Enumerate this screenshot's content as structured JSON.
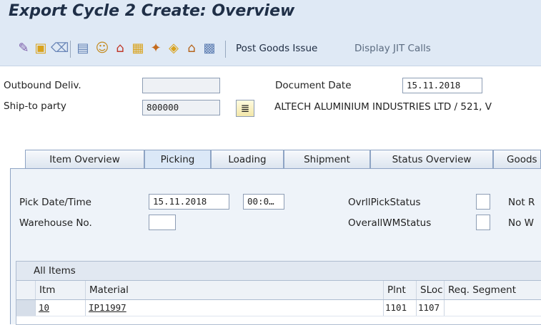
{
  "window": {
    "title": "Export Cycle 2  Create: Overview"
  },
  "toolbar": {
    "icons": [
      "edit-pencil-icon",
      "create-doc-icon",
      "delete-trash-icon",
      "other-delivery-icon",
      "partner-icon",
      "output-icon",
      "texts-icon",
      "packing-icon",
      "shipment-icon",
      "header-icon",
      "overview-grid-icon"
    ],
    "post_goods_issue": "Post Goods Issue",
    "display_jit_calls": "Display JIT Calls"
  },
  "header": {
    "outbound_deliv_label": "Outbound Deliv.",
    "outbound_deliv_value": "",
    "document_date_label": "Document Date",
    "document_date_value": "15.11.2018",
    "ship_to_label": "Ship-to party",
    "ship_to_value": "800000",
    "ship_to_name": "ALTECH ALUMINIUM INDUSTRIES LTD / 521, V"
  },
  "tabs": [
    {
      "label": "Item Overview",
      "active": false
    },
    {
      "label": "Picking",
      "active": true
    },
    {
      "label": "Loading",
      "active": false
    },
    {
      "label": "Shipment",
      "active": false
    },
    {
      "label": "Status Overview",
      "active": false
    },
    {
      "label": "Goods",
      "active": false
    }
  ],
  "picking": {
    "pick_date_label": "Pick Date/Time",
    "pick_date_value": "15.11.2018",
    "pick_time_value": "00:0…",
    "warehouse_label": "Warehouse No.",
    "warehouse_value": "",
    "ovrl_pick_status_label": "OvrllPickStatus",
    "ovrl_pick_status_text": "Not R",
    "overall_wm_status_label": "OverallWMStatus",
    "overall_wm_status_text": "No W"
  },
  "items_table": {
    "title": "All Items",
    "columns": [
      "Itm",
      "Material",
      "Plnt",
      "SLoc",
      "Req. Segment"
    ],
    "rows": [
      {
        "itm": "10",
        "material": "IP11997",
        "plnt": "1101",
        "sloc": "1107",
        "req_segment": ""
      }
    ]
  },
  "colors": {
    "band": "#dfe9f5",
    "tab_body": "#eef3f9",
    "title_text": "#1f2f47"
  }
}
